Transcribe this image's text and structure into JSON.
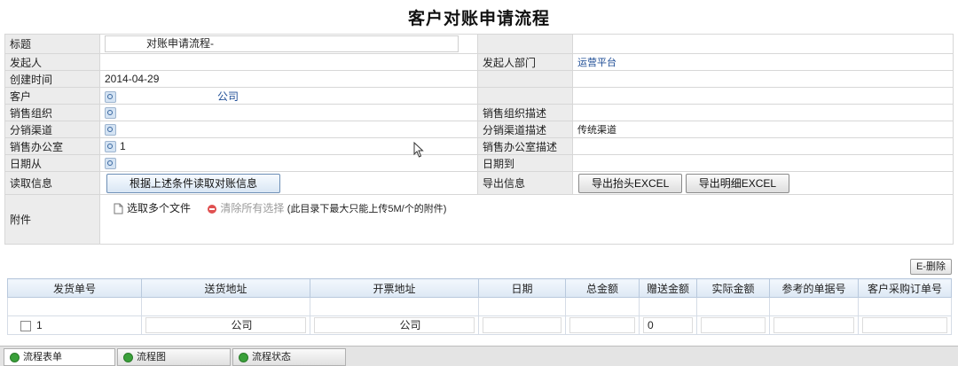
{
  "page_title": "客户对账申请流程",
  "form": {
    "title_label": "标题",
    "title_value": "对账申请流程-",
    "initiator_label": "发起人",
    "initiator_value": "",
    "initiator_dept_label": "发起人部门",
    "initiator_dept_value": "运营平台",
    "created_label": "创建时间",
    "created_value": "2014-04-29",
    "customer_label": "客户",
    "customer_value": "公司",
    "sales_org_label": "销售组织",
    "sales_org_desc_label": "销售组织描述",
    "channel_label": "分销渠道",
    "channel_desc_label": "分销渠道描述",
    "channel_desc_value": "传统渠道",
    "office_label": "销售办公室",
    "office_value": "1",
    "office_desc_label": "销售办公室描述",
    "date_from_label": "日期从",
    "date_to_label": "日期到",
    "read_label": "读取信息",
    "read_button": "根据上述条件读取对账信息",
    "export_label": "导出信息",
    "export_header_button": "导出抬头EXCEL",
    "export_detail_button": "导出明细EXCEL",
    "attach_label": "附件",
    "select_files": "选取多个文件",
    "clear_all": "清除所有选择",
    "upload_hint": "(此目录下最大只能上传5M/个的附件)"
  },
  "delete_button": "E-删除",
  "grid": {
    "headers": [
      "发货单号",
      "送货地址",
      "开票地址",
      "日期",
      "总金额",
      "赠送金额",
      "实际金额",
      "参考的单据号",
      "客户采购订单号"
    ],
    "row": {
      "index": "1",
      "delivery_addr": "公司",
      "invoice_addr": "公司",
      "gift_amount": "0"
    }
  },
  "bottom_tabs": [
    "流程表单",
    "流程图",
    "流程状态"
  ]
}
